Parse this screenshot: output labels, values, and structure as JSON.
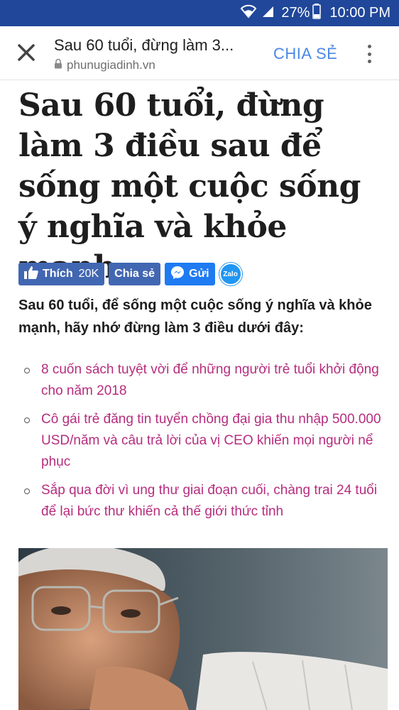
{
  "status_bar": {
    "battery": "27%",
    "time": "10:00 PM"
  },
  "toolbar": {
    "title": "Sau 60 tuổi, đừng làm 3...",
    "url": "phunugiadinh.vn",
    "share_label": "CHIA SẺ"
  },
  "article": {
    "headline": "Sau 60 tuổi, đừng làm 3 điều sau để sống một cuộc sống ý nghĩa và khỏe mạnh",
    "social": {
      "like_label": "Thích",
      "like_count": "20K",
      "share_label": "Chia sẻ",
      "send_label": "Gửi",
      "zalo_label": "Zalo"
    },
    "sapo": "Sau 60 tuổi, để sống một cuộc sống ý nghĩa và khỏe mạnh, hãy nhớ đừng làm 3 điều dưới đây:",
    "related": [
      {
        "text": "8 cuốn sách tuyệt vời để những người trẻ tuổi khởi động cho năm 2018"
      },
      {
        "text": "Cô gái trẻ đăng tin tuyển chồng đại gia thu nhập 500.000 USD/năm và câu trả lời của vị CEO khiến mọi người nể phục"
      },
      {
        "text": "Sắp qua đời vì ung thư giai đoạn cuối, chàng trai 24 tuổi để lại bức thư khiến cả thế giới thức tỉnh"
      }
    ]
  },
  "colors": {
    "status_bar": "#20479a",
    "share_accent": "#4b88e6",
    "related_link": "#b62d7e",
    "facebook": "#4267b2",
    "messenger": "#1f7bf2"
  }
}
